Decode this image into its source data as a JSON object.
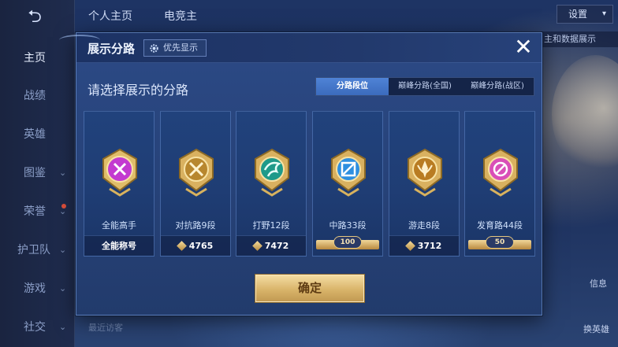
{
  "background": {
    "top_tabs": [
      "个人主页",
      "电竞主"
    ],
    "settings_label": "设置",
    "right_peek_text": "主和数据展示",
    "visitors_text": "最近访客",
    "right_buttons": [
      "信息",
      "换英雄"
    ],
    "sidebar": [
      {
        "label": "主页",
        "active": true,
        "chevron": false
      },
      {
        "label": "战绩",
        "active": false,
        "chevron": false
      },
      {
        "label": "英雄",
        "active": false,
        "chevron": false
      },
      {
        "label": "图鉴",
        "active": false,
        "chevron": true
      },
      {
        "label": "荣誉",
        "active": false,
        "chevron": true
      },
      {
        "label": "护卫队",
        "active": false,
        "chevron": true
      },
      {
        "label": "游戏",
        "active": false,
        "chevron": true
      },
      {
        "label": "社交",
        "active": false,
        "chevron": true
      }
    ]
  },
  "modal": {
    "title": "展示分路",
    "priority_label": "优先显示",
    "close_icon": "close-icon",
    "subtitle": "请选择展示的分路",
    "tabs": [
      {
        "label": "分路段位",
        "active": true
      },
      {
        "label": "巅峰分路(全国)",
        "active": false
      },
      {
        "label": "巅峰分路(战区)",
        "active": false
      }
    ],
    "cards": [
      {
        "label": "全能高手",
        "foot_type": "text",
        "foot": "全能称号",
        "badge": "all-round-badge-icon",
        "color": "#c33ad0"
      },
      {
        "label": "对抗路9段",
        "foot_type": "points",
        "foot": "4765",
        "badge": "clash-lane-badge-icon",
        "color": "#c79a35"
      },
      {
        "label": "打野12段",
        "foot_type": "points",
        "foot": "7472",
        "badge": "jungle-badge-icon",
        "color": "#1f9a8a"
      },
      {
        "label": "中路33段",
        "foot_type": "scroll",
        "foot": "100",
        "badge": "mid-lane-badge-icon",
        "color": "#2e8fe0"
      },
      {
        "label": "游走8段",
        "foot_type": "points",
        "foot": "3712",
        "badge": "roam-badge-icon",
        "color": "#c88a2a"
      },
      {
        "label": "发育路44段",
        "foot_type": "scroll",
        "foot": "50",
        "badge": "farm-lane-badge-icon",
        "color": "#d94fb8"
      }
    ],
    "confirm_label": "确定"
  }
}
